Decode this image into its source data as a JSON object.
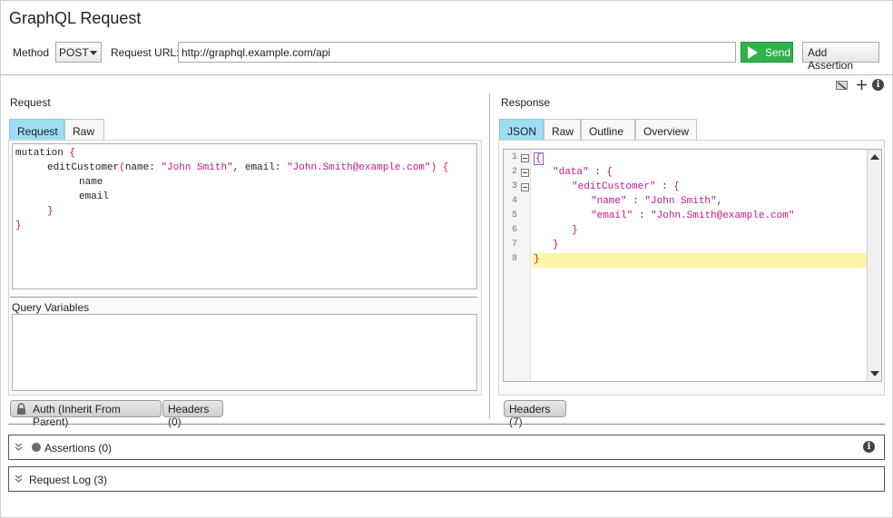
{
  "window": {
    "title": "GraphQL Request"
  },
  "toolbar": {
    "method_label": "Method",
    "method_value": "POST",
    "url_label": "Request URL:",
    "url_value": "http://graphql.example.com/api",
    "send_label": "Send",
    "add_assertion_label": "Add Assertion",
    "send_color": "#2fb24a"
  },
  "request": {
    "heading": "Request",
    "tabs": [
      {
        "label": "Request",
        "active": true
      },
      {
        "label": "Raw",
        "active": false
      }
    ],
    "query_lines": [
      "mutation {",
      "editCustomer(name: \"John Smith\", email: \"John.Smith@example.com\") {",
      "name",
      "email",
      "}",
      "}"
    ],
    "variables_label": "Query Variables",
    "bottom_tabs": [
      {
        "label": "Auth (Inherit From Parent)",
        "icon": "lock-icon"
      },
      {
        "label": "Headers (0)"
      }
    ]
  },
  "response": {
    "heading": "Response",
    "tabs": [
      {
        "label": "JSON",
        "active": true
      },
      {
        "label": "Raw",
        "active": false
      },
      {
        "label": "Outline",
        "active": false
      },
      {
        "label": "Overview",
        "active": false
      }
    ],
    "line_numbers": [
      "1",
      "2",
      "3",
      "4",
      "5",
      "6",
      "7",
      "8"
    ],
    "json_lines": [
      "{",
      "\"data\" : {",
      "\"editCustomer\" : {",
      "\"name\" : \"John Smith\",",
      "\"email\" : \"John.Smith@example.com\"",
      "}",
      "}",
      "}"
    ],
    "highlight_line": 8,
    "highlight_color": "#fcf6a6",
    "bottom_tabs": [
      {
        "label": "Headers (7)"
      }
    ],
    "tool_icons": [
      "format-icon",
      "plus-icon",
      "info-icon"
    ]
  },
  "sections": [
    {
      "label": "Assertions (0)",
      "status_icon": "status-dot-icon",
      "has_info": true
    },
    {
      "label": "Request Log (3)"
    }
  ]
}
